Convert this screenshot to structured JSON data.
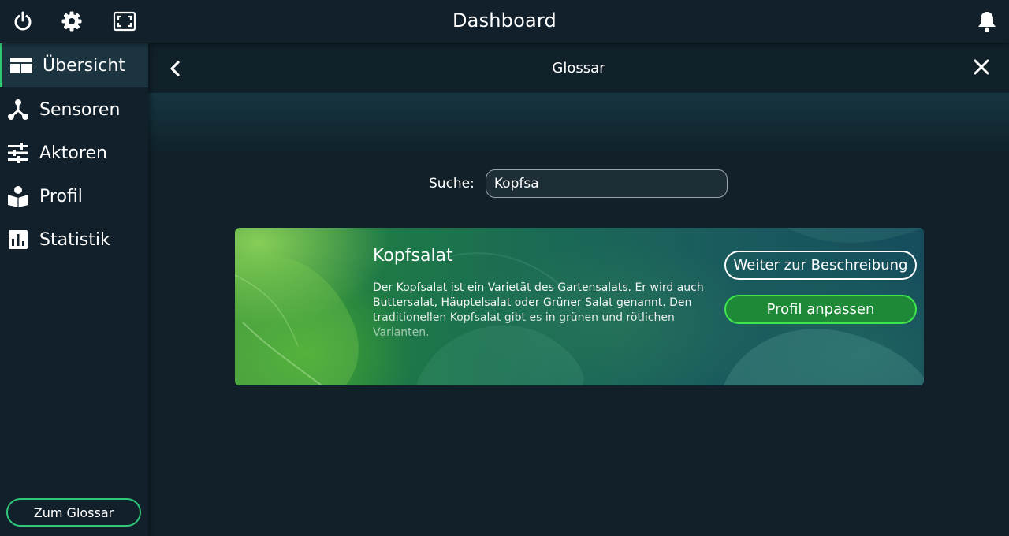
{
  "topbar": {
    "title": "Dashboard",
    "icons": [
      "power-icon",
      "gear-icon",
      "fullscreen-icon",
      "bell-icon"
    ]
  },
  "sidebar": {
    "items": [
      {
        "label": "Übersicht",
        "icon": "overview-icon",
        "active": true
      },
      {
        "label": "Sensoren",
        "icon": "sensor-icon",
        "active": false
      },
      {
        "label": "Aktoren",
        "icon": "sliders-icon",
        "active": false
      },
      {
        "label": "Profil",
        "icon": "reading-person-icon",
        "active": false
      },
      {
        "label": "Statistik",
        "icon": "bar-chart-icon",
        "active": false
      }
    ],
    "glossar_button": "Zum Glossar"
  },
  "subheader": {
    "title": "Glossar"
  },
  "search": {
    "label": "Suche:",
    "value": "Kopfsa"
  },
  "card": {
    "title": "Kopfsalat",
    "description": "Der Kopfsalat ist ein Varietät des Gartensalats. Er wird auch Buttersalat, Häuptelsalat oder Grüner Salat genannt. Den traditionellen Kopfsalat gibt es in grünen und rötlichen Varianten.",
    "button_description": "Weiter zur Beschreibung",
    "button_profile": "Profil anpassen"
  },
  "colors": {
    "background": "#122129",
    "accent": "#30c878",
    "button_green": "#1e8a38",
    "button_green_border": "#3ee64c"
  }
}
